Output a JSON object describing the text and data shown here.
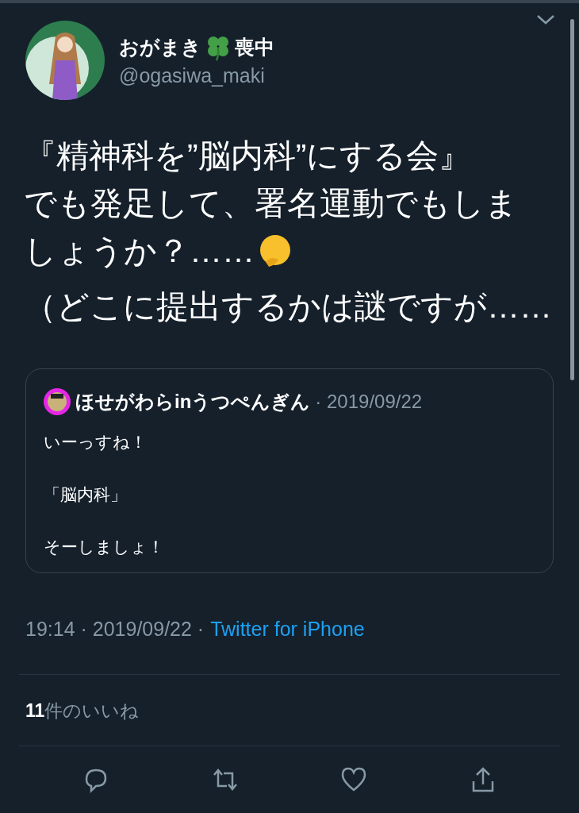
{
  "author": {
    "name": "おがまき",
    "name_suffix": "喪中",
    "handle": "@ogasiwa_maki"
  },
  "tweet_lines": [
    {
      "kind": "plain",
      "text": "『精神科を”脳内科”にする会』"
    },
    {
      "kind": "plain",
      "text": "でも発足して、署名運動でもしま"
    },
    {
      "kind": "with_emoji",
      "text": "しょうか？……"
    },
    {
      "kind": "plain",
      "text": "（どこに提出するかは謎ですが……"
    }
  ],
  "quote": {
    "name": "ほせがわらinうつぺんぎん",
    "date": "· 2019/09/22",
    "paragraphs": [
      "いーっすね！",
      "「脳内科」",
      "そーしましょ！"
    ]
  },
  "meta": {
    "time": "19:14 · 2019/09/22 ·",
    "source": "Twitter for iPhone"
  },
  "likes": {
    "count": "11",
    "label": "件のいいね"
  }
}
